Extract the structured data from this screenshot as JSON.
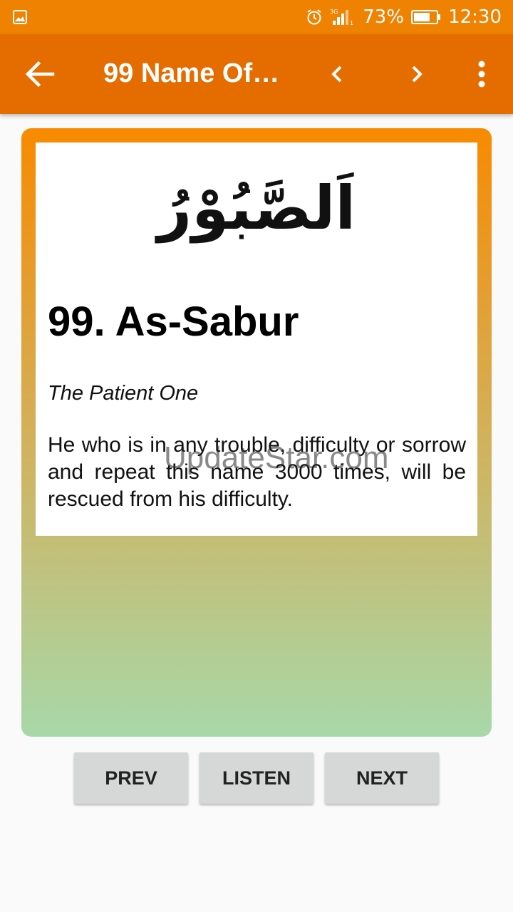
{
  "status_bar": {
    "battery_percent": "73%",
    "time": "12:30",
    "network": "3G",
    "icons": [
      "image-notification-icon",
      "alarm-icon",
      "signal-icon",
      "battery-icon"
    ],
    "battery_level": 0.73
  },
  "app_bar": {
    "title": "99 Name Of…",
    "icons": [
      "back-arrow-icon",
      "chevron-left-icon",
      "chevron-right-icon",
      "more-vert-icon"
    ]
  },
  "card": {
    "arabic_name": "اَلصَّبُوْرُ",
    "name_title": "99. As-Sabur",
    "meaning": "The Patient One",
    "description": "He who is in any trouble, difficulty or sorrow and repeat this name 3000 times, will be rescued from his difficulty.",
    "watermark": "UpdateStar.com"
  },
  "buttons": {
    "prev": "PREV",
    "listen": "LISTEN",
    "next": "NEXT"
  },
  "colors": {
    "status_bar": "#ef8200",
    "app_bar": "#e56d00",
    "card_gradient_top": "#f88a00",
    "card_gradient_bottom": "#a8d8a9",
    "button_bg": "#d6d7d7"
  }
}
